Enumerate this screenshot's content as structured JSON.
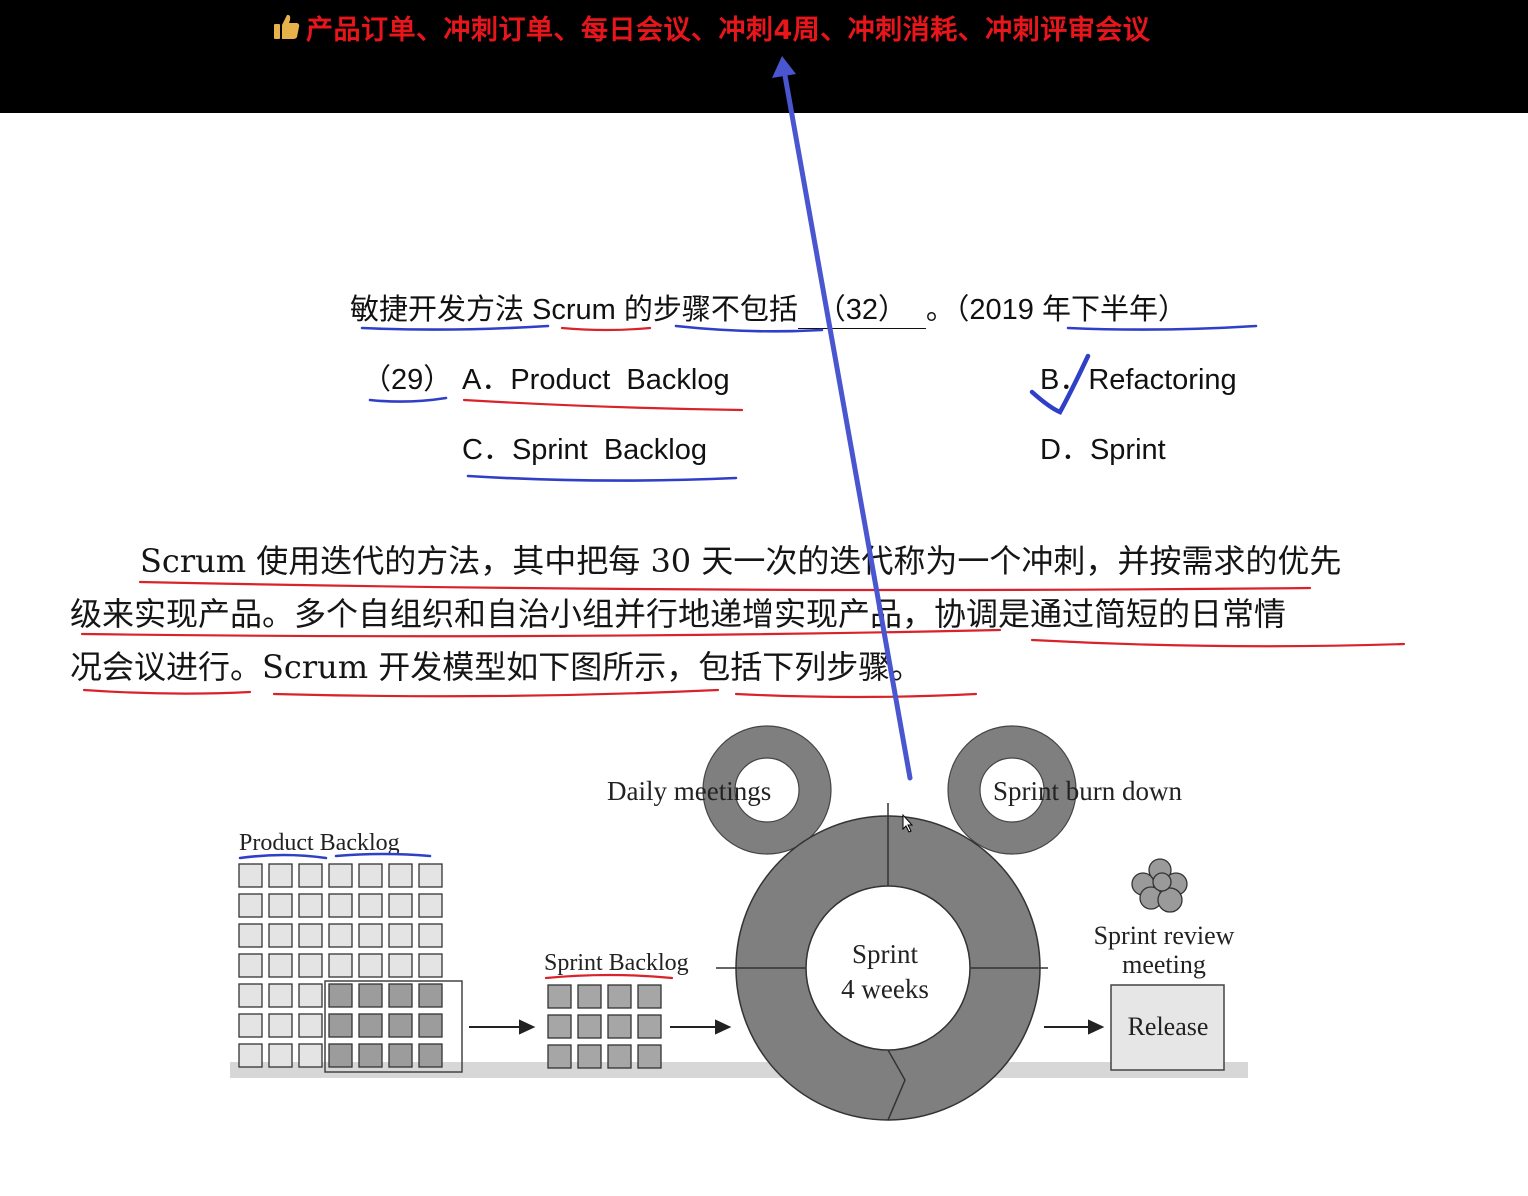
{
  "comment_bar": {
    "icon": "thumbs-up-icon",
    "text": "产品订单、冲刺订单、每日会议、冲刺4周、冲刺消耗、冲刺评审会议"
  },
  "question": {
    "stem_before": "敏捷开发方法 Scrum 的步骤不包括",
    "blank": "（32）",
    "stem_after": "。（2019 年下半年）",
    "other_number": "（29）",
    "options": [
      {
        "key": "A．",
        "text": "Product  Backlog"
      },
      {
        "key": "B．",
        "text": "Refactoring"
      },
      {
        "key": "C．",
        "text": "Sprint  Backlog"
      },
      {
        "key": "D．",
        "text": "Sprint"
      }
    ]
  },
  "paragraph": {
    "line1": "Scrum 使用迭代的方法，其中把每 30 天一次的迭代称为一个冲刺，并按需求的优先",
    "line2": "级来实现产品。多个自组织和自治小组并行地递增实现产品，协调是通过简短的日常情",
    "line3": "况会议进行。Scrum 开发模型如下图所示，包括下列步骤。"
  },
  "diagram": {
    "product_backlog": "Product Backlog",
    "sprint_backlog": "Sprint Backlog",
    "daily_meetings": "Daily meetings",
    "sprint_burn_down": "Sprint burn down",
    "sprint_center_1": "Sprint",
    "sprint_center_2": "4 weeks",
    "sprint_review_1": "Sprint review",
    "sprint_review_2": "meeting",
    "release": "Release"
  },
  "annotation_colors": {
    "blue": "#2f3fc8",
    "red": "#d8232a",
    "arrow": "#4a55d0"
  }
}
